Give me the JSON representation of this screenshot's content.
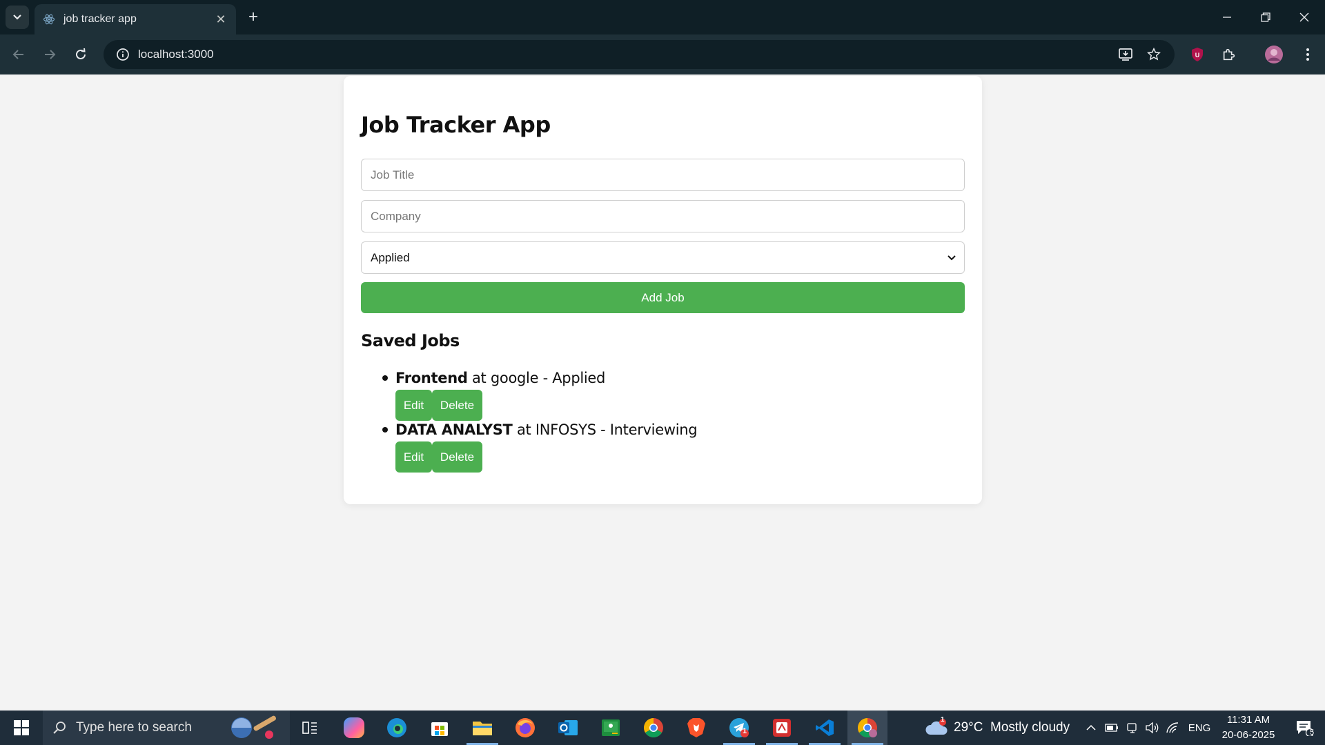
{
  "browser": {
    "tab_title": "job tracker app",
    "url": "localhost:3000"
  },
  "app": {
    "title": "Job Tracker App",
    "job_title_placeholder": "Job Title",
    "company_placeholder": "Company",
    "status_selected": "Applied",
    "add_button": "Add Job",
    "saved_heading": "Saved Jobs",
    "jobs": [
      {
        "title": "Frontend",
        "company": "google",
        "status": "Applied",
        "edit_label": "Edit",
        "delete_label": "Delete"
      },
      {
        "title": "DATA ANALYST",
        "company": "INFOSYS",
        "status": "Interviewing",
        "edit_label": "Edit",
        "delete_label": "Delete"
      }
    ],
    "accent_color": "#4caf50"
  },
  "taskbar": {
    "search_placeholder": "Type here to search",
    "weather": "29°C  Mostly cloudy",
    "weather_badge": "1",
    "lang": "ENG",
    "time": "11:31 AM",
    "date": "20-06-2025",
    "notification_count": "5",
    "telegram_badge": "1",
    "apps": [
      "task-view",
      "copilot",
      "edge",
      "store",
      "file-explorer",
      "firefox",
      "outlook",
      "classroom",
      "chrome",
      "brave",
      "telegram",
      "acrobat",
      "vscode",
      "chrome-profile"
    ]
  }
}
